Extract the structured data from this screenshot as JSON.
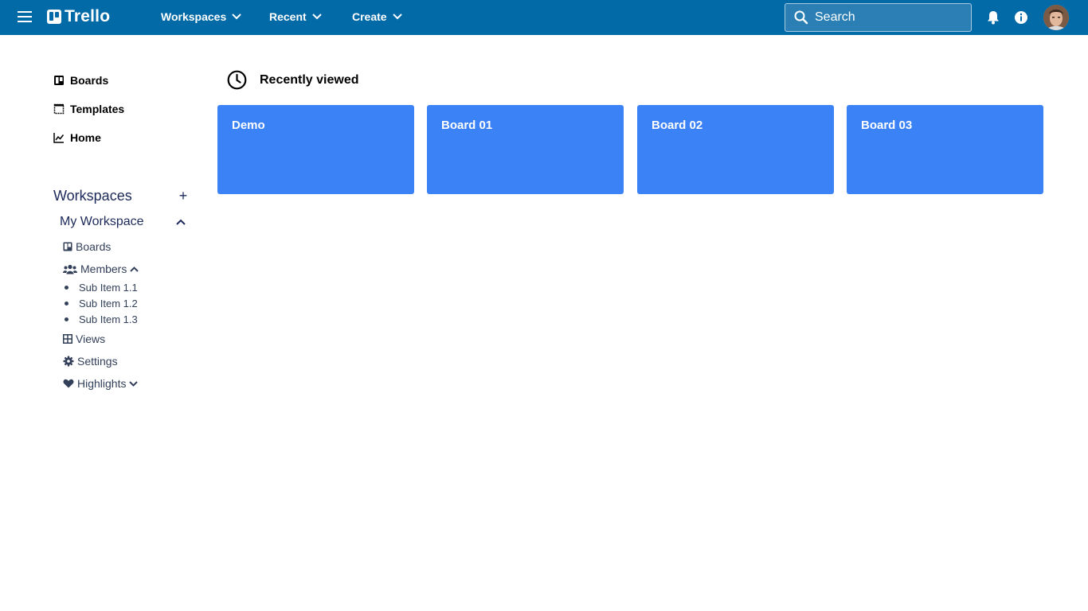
{
  "topbar": {
    "logo_text": "Trello",
    "nav": [
      {
        "label": "Workspaces"
      },
      {
        "label": "Recent"
      },
      {
        "label": "Create"
      }
    ],
    "search_placeholder": "Search",
    "color": "#026aa7"
  },
  "sidebar": {
    "links": [
      {
        "label": "Boards",
        "icon": "board-icon"
      },
      {
        "label": "Templates",
        "icon": "template-icon"
      },
      {
        "label": "Home",
        "icon": "activity-chart-icon"
      }
    ],
    "workspaces_title": "Workspaces",
    "add_symbol": "+",
    "my_workspace": {
      "label": "My Workspace",
      "items": {
        "boards": "Boards",
        "members": "Members",
        "sub_items": [
          "Sub Item 1.1",
          "Sub Item 1.2",
          "Sub Item 1.3"
        ],
        "views": "Views",
        "settings": "Settings",
        "highlights": "Highlights"
      }
    }
  },
  "main": {
    "recently_viewed_title": "Recently viewed",
    "boards": [
      {
        "name": "Demo"
      },
      {
        "name": "Board 01"
      },
      {
        "name": "Board 02"
      },
      {
        "name": "Board 03"
      }
    ],
    "board_color": "#3b82f6"
  }
}
